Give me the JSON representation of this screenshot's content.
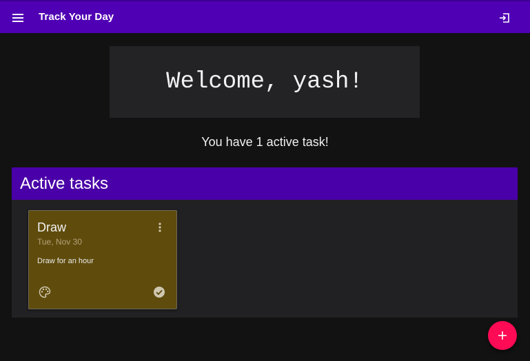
{
  "appbar": {
    "title": "Track Your Day",
    "menu_icon": "menu-icon",
    "logout_icon": "logout-icon",
    "color": "#5000b4"
  },
  "welcome": {
    "text": "Welcome, yash!"
  },
  "summary": {
    "text": "You have 1 active task!"
  },
  "active_tasks": {
    "title": "Active tasks",
    "header_color": "#4a00a8",
    "tasks": [
      {
        "title": "Draw",
        "date": "Tue, Nov 30",
        "description": "Draw for an hour",
        "color": "#5f4b0c",
        "more_icon": "more-vert-icon",
        "palette_icon": "palette-icon",
        "done_icon": "check-circle-icon"
      }
    ]
  },
  "fab": {
    "icon": "plus-icon",
    "color": "#ff0a55"
  }
}
